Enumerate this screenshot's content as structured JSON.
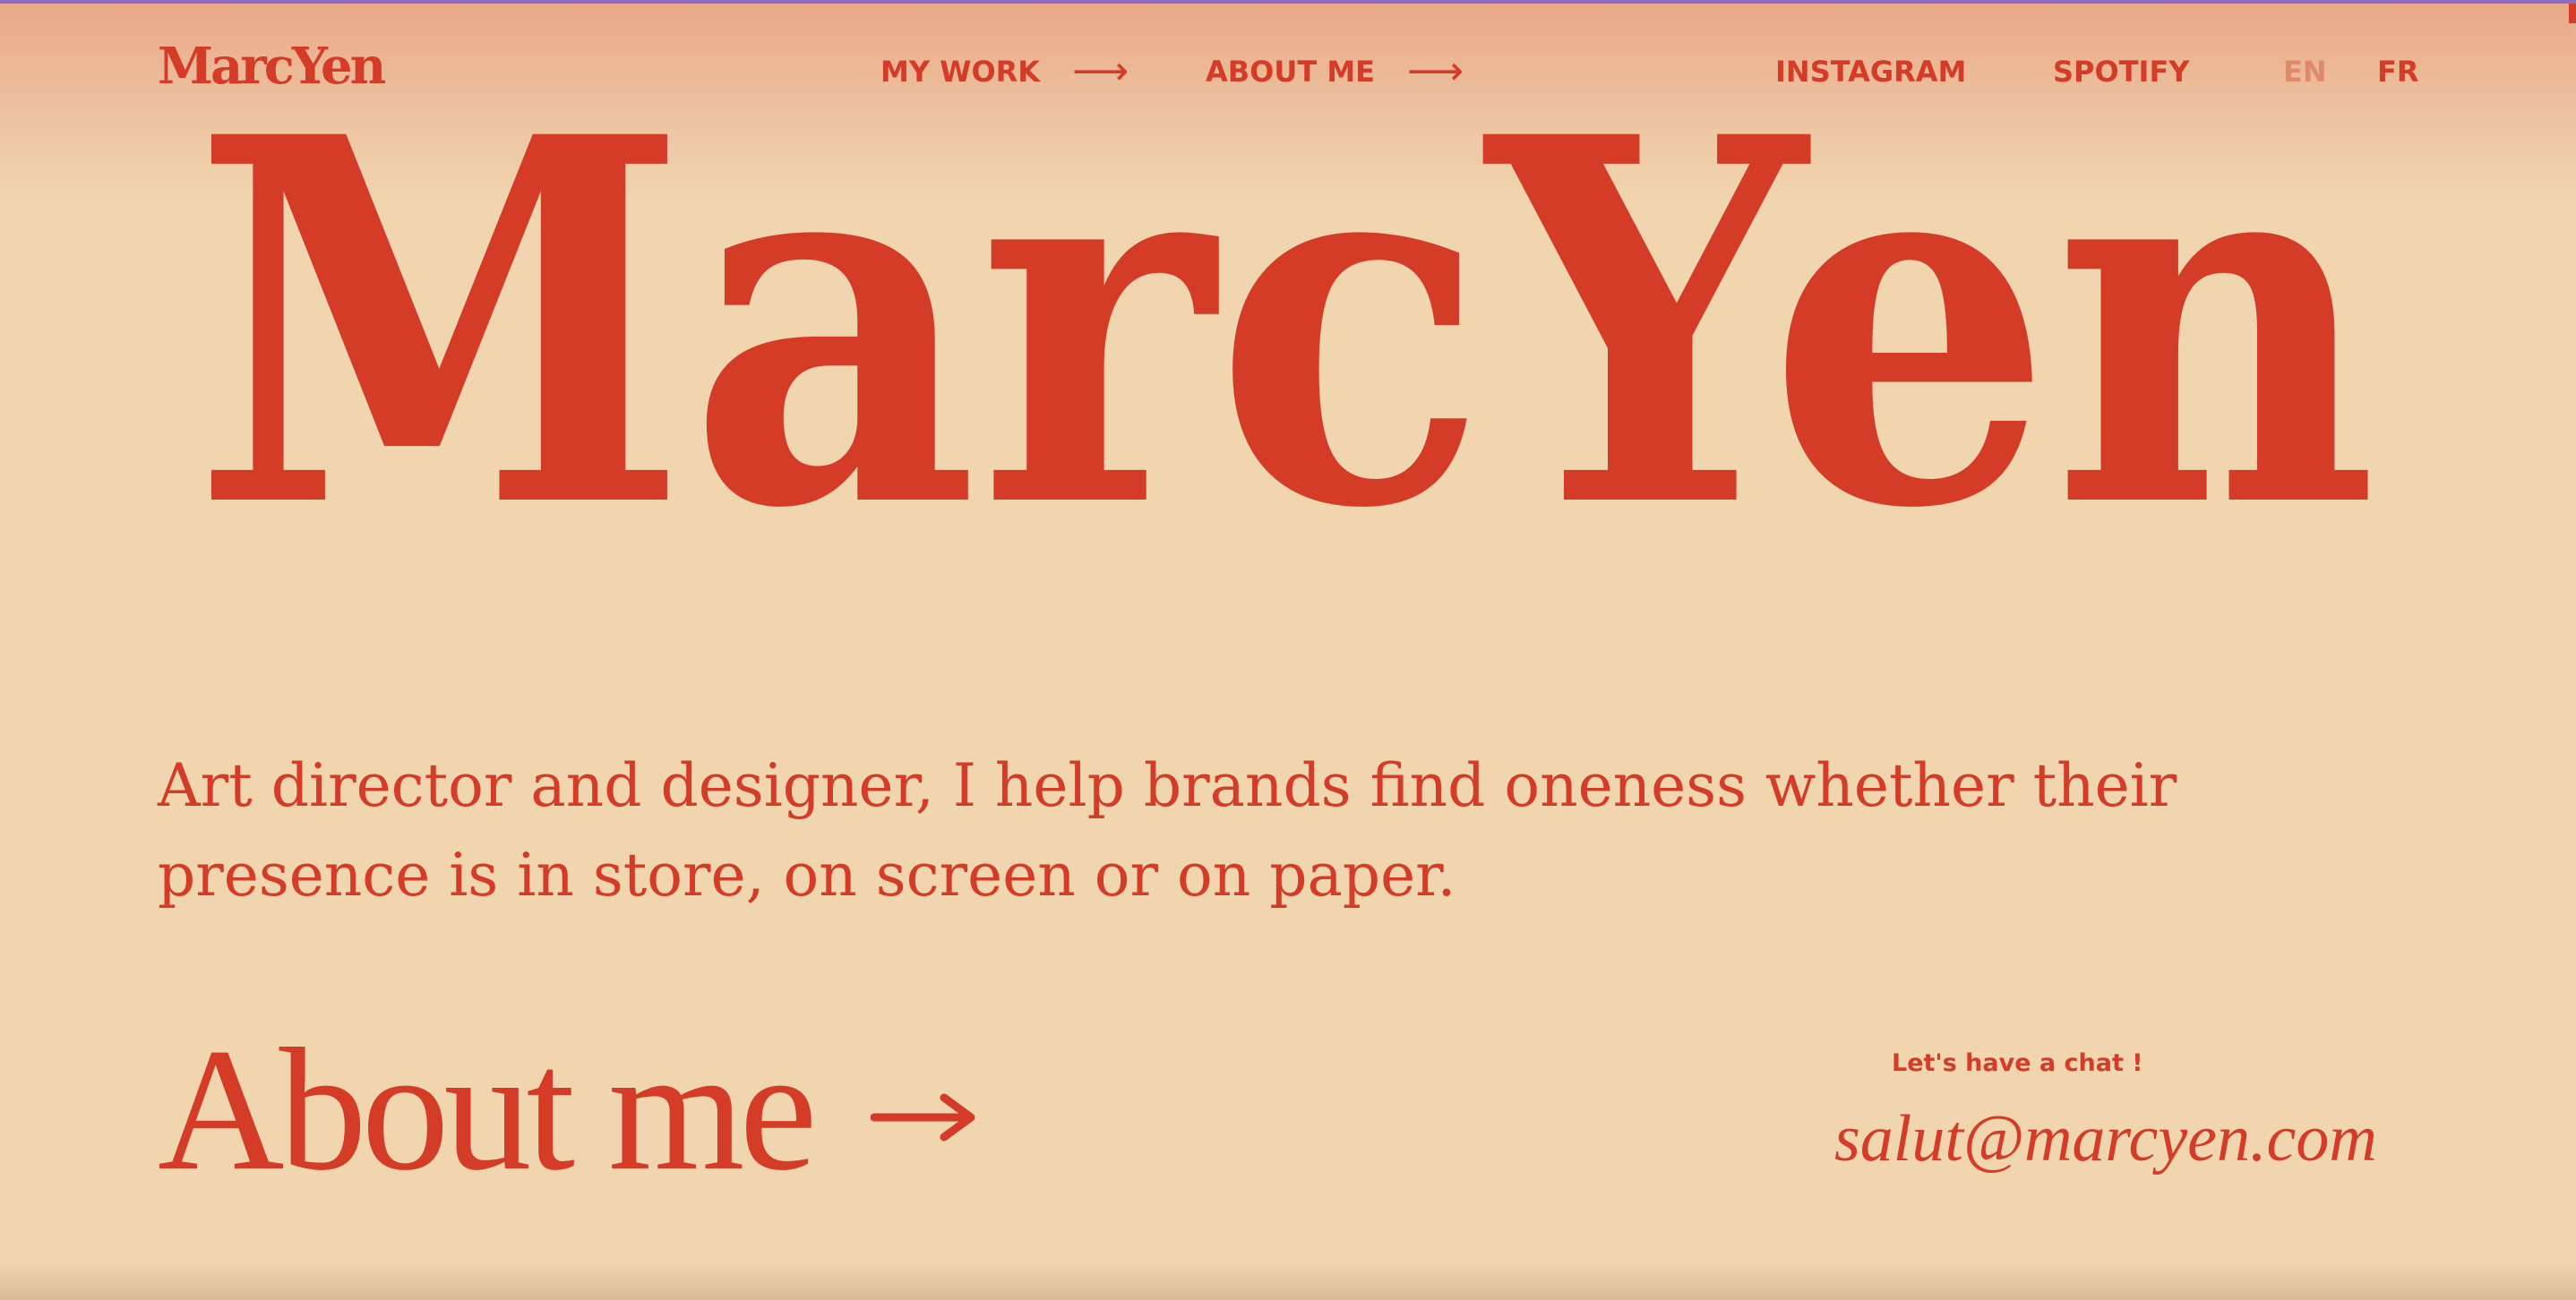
{
  "header": {
    "logo": "MarcYen",
    "nav": {
      "my_work": "MY WORK",
      "about_me": "ABOUT ME",
      "instagram": "INSTAGRAM",
      "spotify": "SPOTIFY",
      "lang_en": "EN",
      "lang_fr": "FR"
    },
    "active_language": "EN"
  },
  "hero": {
    "wordmark": "MarcYen"
  },
  "intro": {
    "text": "Art director and designer, I help brands find oneness whether their presence is in store, on screen or on paper."
  },
  "about": {
    "title": "About me"
  },
  "contact": {
    "label": "Let's have a chat !",
    "email": "salut@marcyen.com"
  },
  "icons": {
    "nav_arrow": "arrow-right-icon",
    "about_arrow": "arrow-right-icon"
  },
  "colors": {
    "background": "#f0d5af",
    "accent": "#d43c27",
    "header_gradient_top": "#eaa887",
    "inactive_language": "#e08a6c"
  }
}
